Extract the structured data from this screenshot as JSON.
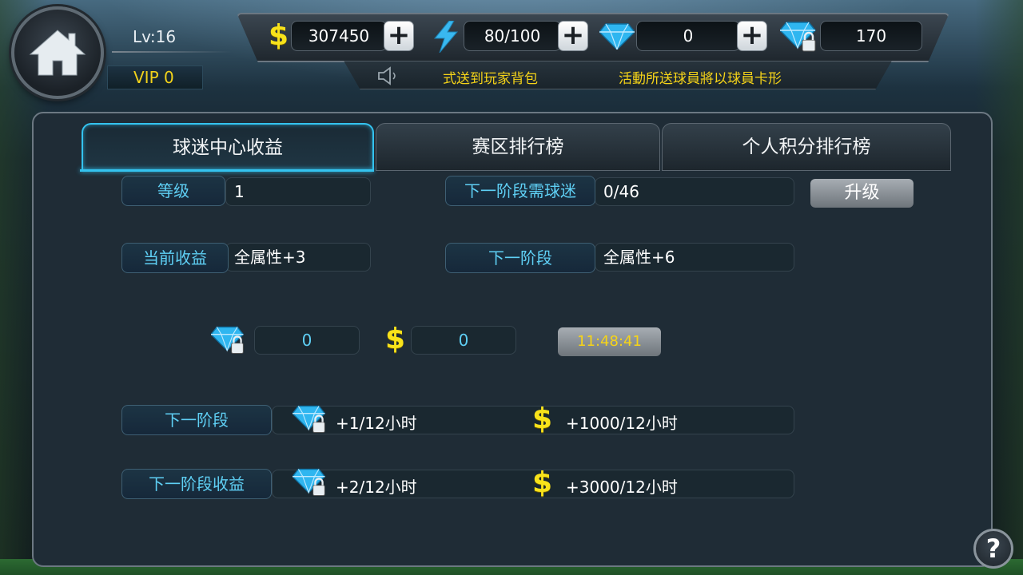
{
  "player": {
    "level": "Lv:16",
    "vip": "VIP 0"
  },
  "resources": {
    "coins": "307450",
    "energy": "80/100",
    "diamonds": "0",
    "locked_diamonds": "170"
  },
  "marquee": {
    "left": "式送到玩家背包",
    "right": "活動所送球員將以球員卡形"
  },
  "tabs": [
    {
      "label": "球迷中心收益",
      "active": true
    },
    {
      "label": "赛区排行榜",
      "active": false
    },
    {
      "label": "个人积分排行榜",
      "active": false
    }
  ],
  "fan_center": {
    "level_label": "等级",
    "level_value": "1",
    "next_stage_fans_label": "下一阶段需球迷",
    "next_stage_fans_value": "0/46",
    "upgrade_label": "升级",
    "current_income_label": "当前收益",
    "current_income_value": "全属性+3",
    "next_stage_label": "下一阶段",
    "next_stage_value": "全属性+6",
    "collect_diamonds": "0",
    "collect_coins": "0",
    "timer": "11:48:41",
    "next_stage_row_label": "下一阶段",
    "next_stage_row_diamond": "+1/12小时",
    "next_stage_row_coins": "+1000/12小时",
    "next_income_row_label": "下一阶段收益",
    "next_income_row_diamond": "+2/12小时",
    "next_income_row_coins": "+3000/12小时"
  },
  "help": {
    "label": "?"
  },
  "colors": {
    "accent_cyan": "#34c3ef",
    "gold": "#f6d418",
    "panel_bg": "#1f2c36"
  },
  "icons": {
    "home": "home-icon",
    "coin": "dollar-icon",
    "energy": "lightning-bolt-icon",
    "diamond": "diamond-icon",
    "locked_diamond": "locked-diamond-icon",
    "speaker": "speaker-icon",
    "help": "question-icon"
  }
}
